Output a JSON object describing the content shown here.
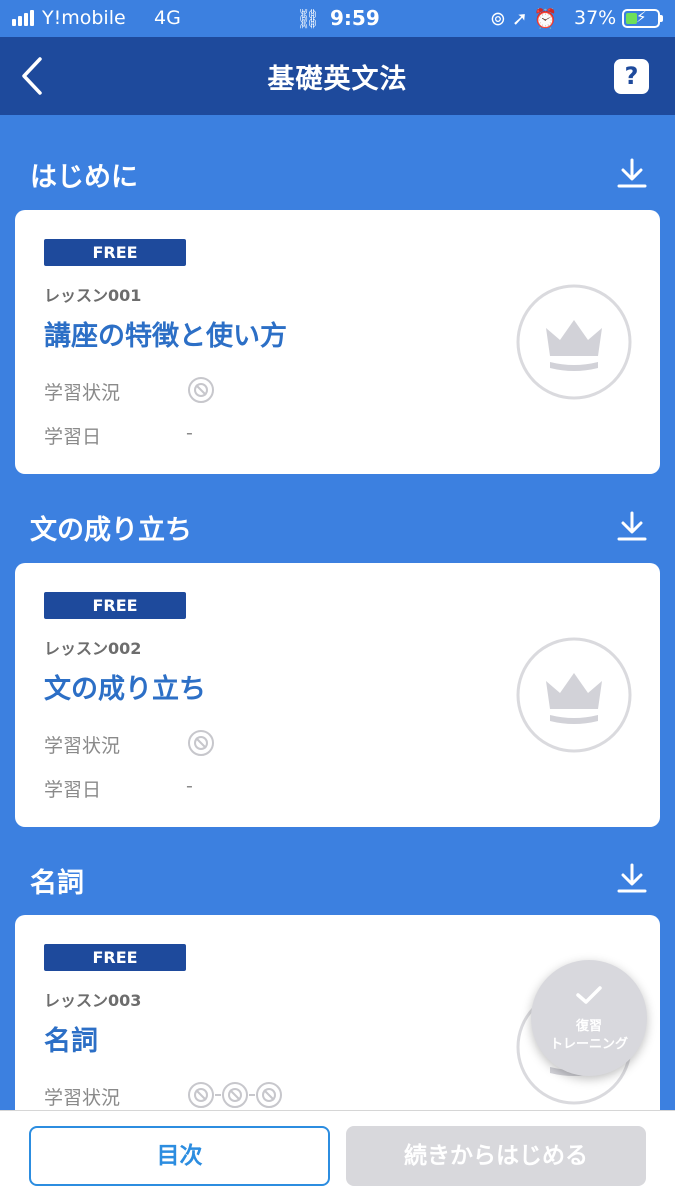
{
  "status_bar": {
    "carrier": "Y!mobile",
    "network": "4G",
    "time": "9:59",
    "battery_percent": "37%",
    "battery_level": 0.37,
    "icons": [
      "link-icon",
      "orientation-lock-icon",
      "location-icon",
      "alarm-icon",
      "battery-charging-icon"
    ]
  },
  "nav": {
    "title": "基礎英文法",
    "help_label": "?"
  },
  "sections": [
    {
      "title": "はじめに",
      "lesson": {
        "badge": "FREE",
        "number": "レッスン001",
        "title": "講座の特徴と使い方",
        "status_label": "学習状況",
        "date_label": "学習日",
        "date_value": "-"
      }
    },
    {
      "title": "文の成り立ち",
      "lesson": {
        "badge": "FREE",
        "number": "レッスン002",
        "title": "文の成り立ち",
        "status_label": "学習状況",
        "date_label": "学習日",
        "date_value": "-"
      }
    },
    {
      "title": "名詞",
      "lesson": {
        "badge": "FREE",
        "number": "レッスン003",
        "title": "名詞",
        "status_label": "学習状況"
      }
    }
  ],
  "fab": {
    "line1": "復習",
    "line2": "トレーニング"
  },
  "bottom": {
    "toc_label": "目次",
    "continue_label": "続きからはじめる"
  },
  "colors": {
    "background": "#3c80e0",
    "navbar": "#1e4a9c",
    "lesson_title": "#2c6fc6",
    "toc_border": "#2c8de0",
    "disabled": "#d8d8dc"
  }
}
